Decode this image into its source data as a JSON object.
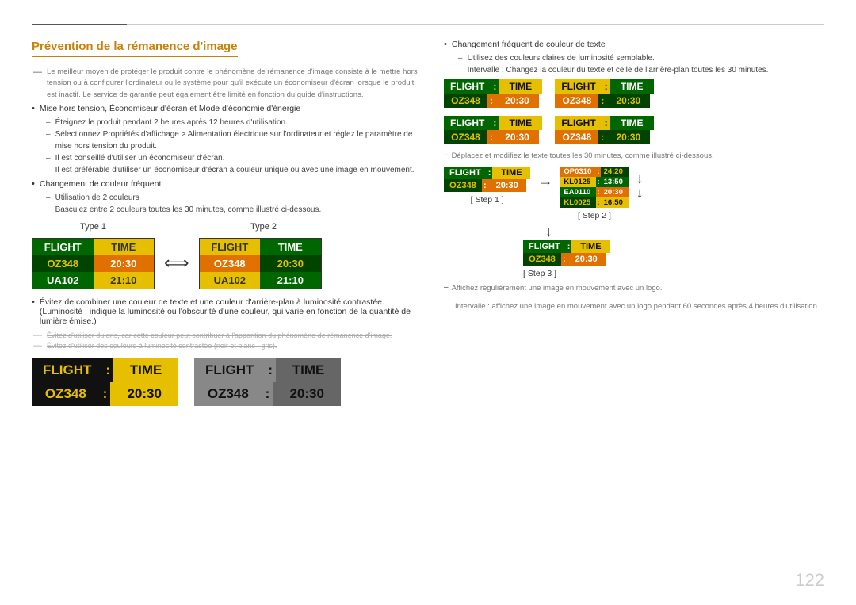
{
  "page": {
    "number": "122",
    "title": "Prévention de la rémanence d'image"
  },
  "left": {
    "intro": "Le meilleur moyen de protéger le produit contre le phénomène de rémanence d'image consiste à le mettre hors tension ou à configurer l'ordinateur ou le système pour qu'il exécute un économiseur d'écran lorsque le produit est inactif. Le service de garantie peut également être limité en fonction du guide d'instructions.",
    "bullet1": "Mise hors tension, Économiseur d'écran et Mode d'économie d'énergie",
    "sub1a": "Éteignez le produit pendant 2 heures après 12 heures d'utilisation.",
    "sub1b": "Sélectionnez Propriétés d'affichage > Alimentation électrique sur l'ordinateur et réglez le paramètre de mise hors tension du produit.",
    "sub1c": "Il est conseillé d'utiliser un économiseur d'écran.",
    "sub1d": "Il est préférable d'utiliser un économiseur d'écran à couleur unique ou avec une image en mouvement.",
    "bullet2": "Changement de couleur fréquent",
    "sub2a": "Utilisation de 2 couleurs",
    "sub2b": "Basculez entre 2 couleurs toutes les 30 minutes, comme illustré ci-dessous.",
    "type1": "Type 1",
    "type2": "Type 2",
    "bullet3": "Évitez de combiner une couleur de texte et une couleur d'arrière-plan à luminosité contrastée. (Luminosité : indique la luminosité ou l'obscurité d'une couleur, qui varie en fonction de la quantité de lumière émise.)",
    "strikethrough1": "Évitez d'utiliser du gris, car cette couleur peut contribuer à l'apparition du phénomène de rémanence d'image.",
    "strikethrough2": "Évitez d'utiliser des couleurs à luminosité contrastée (noir et blanc ; gris)."
  },
  "right": {
    "bullet1": "Changement fréquent de couleur de texte",
    "sub1a": "Utilisez des couleurs claires de luminosité semblable.",
    "sub1b": "Intervalle : Changez la couleur du texte et celle de l'arrière-plan toutes les 30 minutes.",
    "sub2": "Déplacez et modifiez le texte toutes les 30 minutes, comme illustré ci-dessous.",
    "step1_label": "[ Step 1 ]",
    "step2_label": "[ Step 2 ]",
    "step3_label": "[ Step 3 ]",
    "sub3": "Affichez régulièrement une image en mouvement avec un logo.",
    "sub4": "Intervalle : affichez une image en mouvement avec un logo pendant 60 secondes après 4 heures d'utilisation."
  },
  "boards": {
    "flight": "FLIGHT",
    "colon": ":",
    "time": "TIME",
    "oz348": "OZ348",
    "2030": "20:30",
    "ua102": "UA102",
    "2110": "21:10",
    "op0310": "OP0310",
    "t2420": "24:20",
    "kl0125": "KL0125",
    "t1350": "13:50",
    "ea0110": "EA0110",
    "t2030b": "20:30",
    "kl0025": "KL0025",
    "t1650": "16:50"
  }
}
